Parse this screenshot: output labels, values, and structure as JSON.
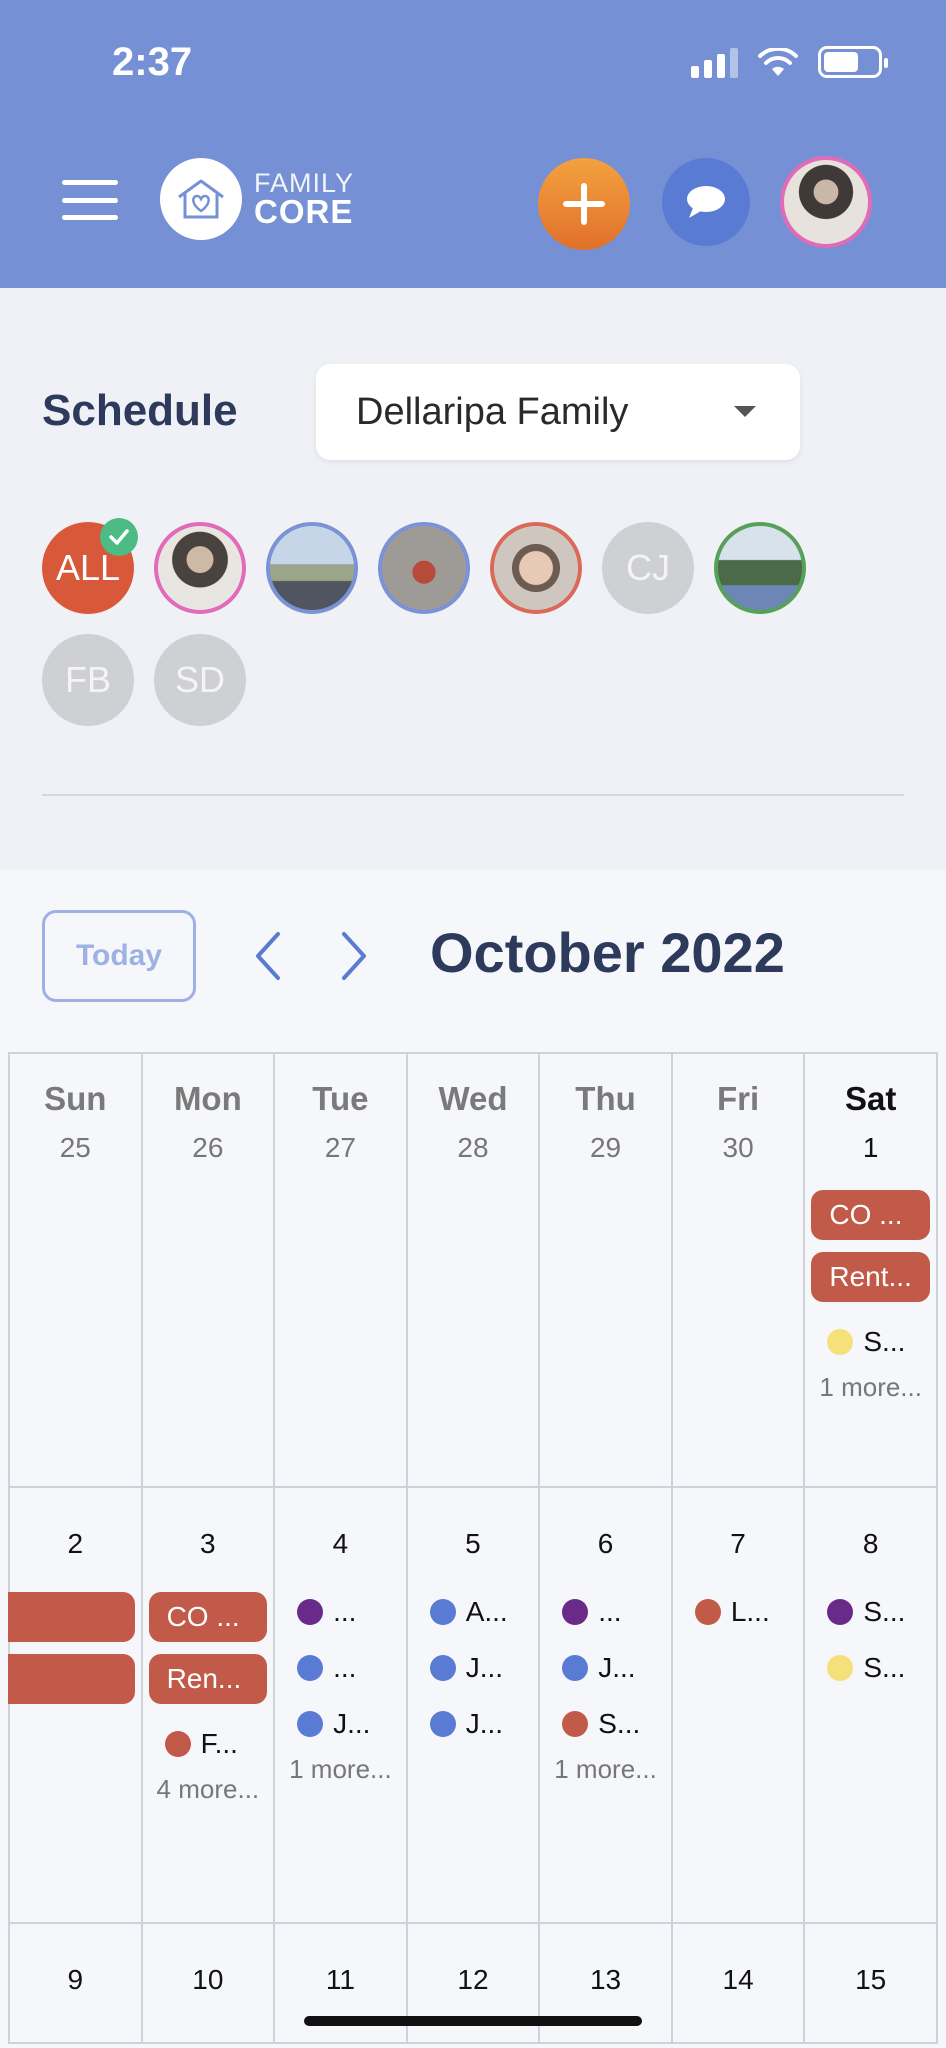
{
  "status": {
    "time": "2:37"
  },
  "header": {
    "logo_line1": "FAMILY",
    "logo_line2": "CORE"
  },
  "schedule": {
    "label": "Schedule",
    "family_select": "Dellaripa Family"
  },
  "members": [
    {
      "type": "all",
      "label": "ALL"
    },
    {
      "type": "photo",
      "label": ""
    },
    {
      "type": "photo",
      "label": ""
    },
    {
      "type": "photo",
      "label": ""
    },
    {
      "type": "photo",
      "label": ""
    },
    {
      "type": "initials",
      "label": "CJ"
    },
    {
      "type": "photo",
      "label": ""
    },
    {
      "type": "initials",
      "label": "FB"
    },
    {
      "type": "initials",
      "label": "SD"
    }
  ],
  "calendar": {
    "today_label": "Today",
    "month_title": "October 2022",
    "day_names": [
      "Sun",
      "Mon",
      "Tue",
      "Wed",
      "Thu",
      "Fri",
      "Sat"
    ],
    "week1_dates": [
      "25",
      "26",
      "27",
      "28",
      "29",
      "30",
      "1"
    ],
    "week2_dates": [
      "2",
      "3",
      "4",
      "5",
      "6",
      "7",
      "8"
    ],
    "week3_dates": [
      "9",
      "10",
      "11",
      "12",
      "13",
      "14",
      "15"
    ],
    "events": {
      "sat1": {
        "bar1": "CO ...",
        "bar2": "Rent...",
        "dot1": "S...",
        "more": "1 more..."
      },
      "mon3": {
        "bar1": "CO ...",
        "bar2": "Ren...",
        "dot1": "F...",
        "more": "4 more..."
      },
      "tue4": {
        "dot1": "...",
        "dot2": "...",
        "dot3": "J...",
        "more": "1 more..."
      },
      "wed5": {
        "dot1": "A...",
        "dot2": "J...",
        "dot3": "J..."
      },
      "thu6": {
        "dot1": "...",
        "dot2": "J...",
        "dot3": "S...",
        "more": "1 more..."
      },
      "fri7": {
        "dot1": "L..."
      },
      "sat8": {
        "dot1": "S...",
        "dot2": "S..."
      }
    },
    "colors": {
      "bar": "#c25a4a",
      "purple": "#6a2a8a",
      "blue": "#5a7bd3",
      "red": "#c25a4a",
      "yellow": "#f6e07a",
      "green": "#3f8f4a"
    }
  }
}
